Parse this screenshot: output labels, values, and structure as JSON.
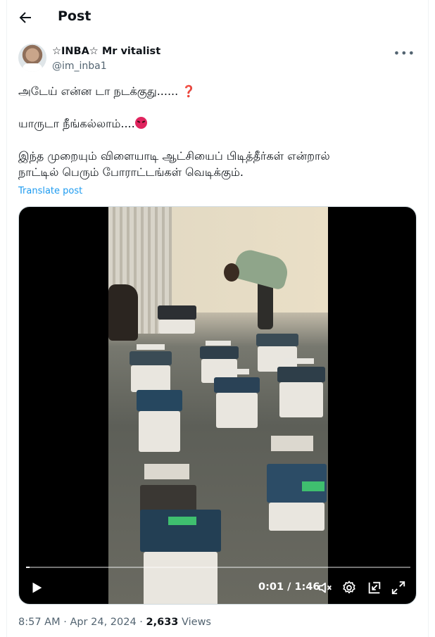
{
  "header": {
    "title": "Post"
  },
  "author": {
    "name": "☆INBA☆ Mr vitalist",
    "handle": "@im_inba1"
  },
  "post": {
    "line1": "அடேய் என்ன டா நடக்குது......",
    "emoji1": "❓",
    "line2": "யாருடா நீங்கல்லாம்....",
    "line3": "இந்த முறையும் விளையாடி ஆட்சியைப் பிடித்தீர்கள் என்றால்",
    "line4": "நாட்டில் பெரும் போராட்டங்கள் வெடிக்கும்.",
    "translate_label": "Translate post"
  },
  "video": {
    "time": "0:01 / 1:46",
    "progress": 0.01
  },
  "meta": {
    "time": "8:57 AM",
    "sep1": " · ",
    "date": "Apr 24, 2024",
    "sep2": " · ",
    "views": "2,633",
    "views_label": " Views"
  },
  "icons": [
    "back-arrow-icon",
    "more-icon",
    "play-icon",
    "mute-icon",
    "settings-icon",
    "pip-icon",
    "fullscreen-icon"
  ],
  "colors": {
    "accent": "#1d9bf0",
    "text": "#0f1419",
    "muted": "#536471"
  }
}
